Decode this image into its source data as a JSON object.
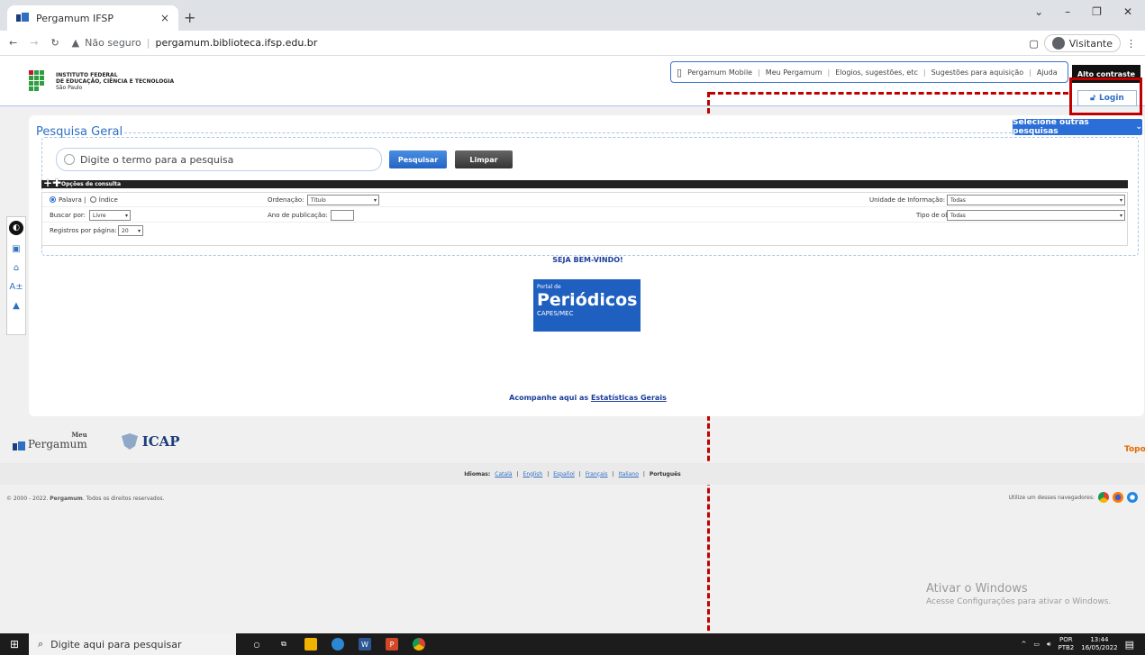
{
  "browser": {
    "tab_title": "Pergamum IFSP",
    "close_tab": "×",
    "new_tab": "+",
    "security_label": "Não seguro",
    "url_separator": "|",
    "url": "pergamum.biblioteca.ifsp.edu.br",
    "profile": "Visitante",
    "win_min": "–",
    "win_max": "❐",
    "win_close": "✕"
  },
  "header": {
    "logo_line1": "INSTITUTO FEDERAL",
    "logo_line2": "DE EDUCAÇÃO, CIÊNCIA E TECNOLOGIA",
    "logo_line3": "São Paulo",
    "nav": [
      "Pergamum Mobile",
      "Meu Pergamum",
      "Elogios, sugestões, etc",
      "Sugestões para aquisição",
      "Ajuda"
    ],
    "nav_separator": "|",
    "alto_contraste": "Alto contraste",
    "login": "Login"
  },
  "sidebar": {
    "contrast": "◐",
    "font_size": "A±"
  },
  "search": {
    "title": "Pesquisa Geral",
    "other_searches": "Selecione outras pesquisas",
    "placeholder": "Digite o termo para a pesquisa",
    "btn_search": "Pesquisar",
    "btn_clear": "Limpar",
    "options_title": "Opções de consulta",
    "radio_palavra": "Palavra |",
    "radio_indice": "Índice",
    "buscar_por_label": "Buscar por:",
    "buscar_por_value": "Livre",
    "ordenacao_label": "Ordenação:",
    "ordenacao_value": "Título",
    "ano_label": "Ano de publicação:",
    "ano_value": "",
    "registros_label": "Registros por página:",
    "registros_value": "20",
    "unidade_label": "Unidade de Informação:",
    "unidade_value": "Todas",
    "tipo_label": "Tipo de obra:",
    "tipo_value": "Todas"
  },
  "content": {
    "welcome": "SEJA BEM-VINDO!",
    "periodicos_small": "Portal de",
    "periodicos_big": "Periódicos",
    "periodicos_sub": "CAPES/MEC",
    "stats_prefix": "Acompanhe aqui as",
    "stats_link": "Estatísticas Gerais"
  },
  "footer": {
    "meu": "Meu",
    "pergamum_logo": "Pergamum",
    "icap": "ICAP",
    "topo": "Topo",
    "idiomas_label": "Idiomas:",
    "languages": [
      "Català",
      "English",
      "Español",
      "Français",
      "Italiano"
    ],
    "current_language": "Português",
    "separator": "|",
    "copyright_prefix": "© 2000 - 2022.",
    "copyright_brand": "Pergamum",
    "copyright_suffix": ". Todos os direitos reservados.",
    "browsers_text": "Utilize um desses navegadores:"
  },
  "activate": {
    "title": "Ativar o Windows",
    "subtitle": "Acesse Configurações para ativar o Windows."
  },
  "taskbar": {
    "search_placeholder": "Digite aqui para pesquisar",
    "lang1": "POR",
    "lang2": "PTB2",
    "time": "13:44",
    "date": "16/05/2022"
  },
  "colors": {
    "accent": "#2e6fc4",
    "annotation": "#c00000"
  }
}
